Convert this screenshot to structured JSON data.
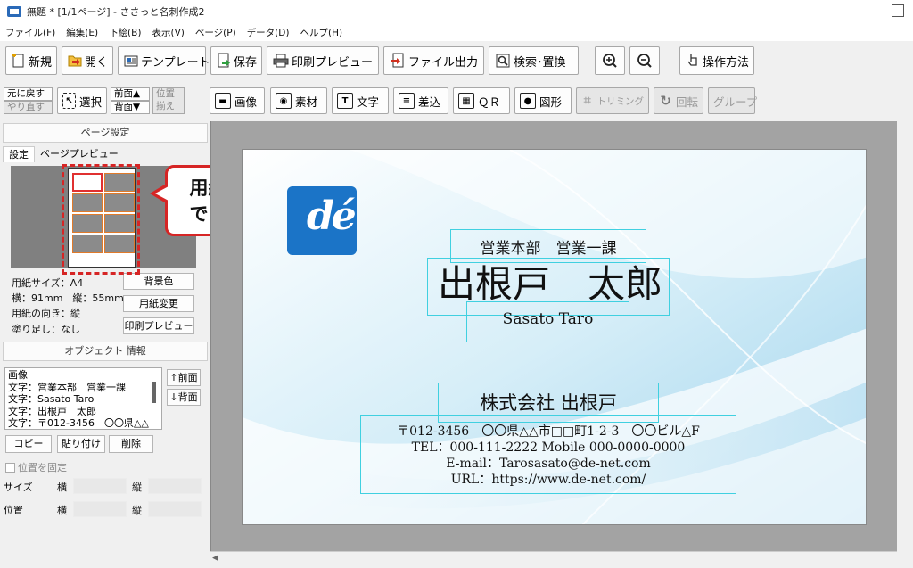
{
  "window": {
    "title": "無題 * [1/1ページ] - ささっと名刺作成2"
  },
  "menu": [
    "ファイル(F)",
    "編集(E)",
    "下絵(B)",
    "表示(V)",
    "ページ(P)",
    "データ(D)",
    "ヘルプ(H)"
  ],
  "toolbar1": {
    "new": "新規",
    "open": "開く",
    "template": "テンプレート",
    "save": "保存",
    "print_preview": "印刷プレビュー",
    "file_output": "ファイル出力",
    "search_replace": "検索･置換",
    "how_to": "操作方法"
  },
  "toolbar2": {
    "undo": "元に戻す",
    "redo": "やり直す",
    "select": "選択",
    "front": "前面▲",
    "back": "背面▼",
    "align_line1": "位置",
    "align_line2": "揃え",
    "image": "画像",
    "material": "素材",
    "text": "文字",
    "insert": "差込",
    "qr": "ＱＲ",
    "shape": "図形",
    "trimming": "トリミング",
    "rotate": "回転",
    "group": "グループ"
  },
  "left": {
    "page_settings": "ページ設定",
    "tab_settings": "設定",
    "tab_preview": "ページプレビュー",
    "paper_size": "用紙サイズ：A4",
    "dimensions": "横：91mm　縦：55mm",
    "orientation": "用紙の向き：縦",
    "bleed": "塗り足し：なし",
    "bg_color_btn": "背景色",
    "change_paper_btn": "用紙変更",
    "print_preview_btn": "印刷プレビュー",
    "object_info": "オブジェクト 情報",
    "objects": [
      "画像",
      "文字：営業本部　営業一課",
      "文字：Sasato Taro",
      "文字：出根戸　太郎",
      "文字：〒012-3456　〇〇県△△"
    ],
    "to_front": "↑前面",
    "to_back": "↓背面",
    "copy": "コピー",
    "paste": "貼り付け",
    "delete": "削除",
    "fix_position": "位置を固定",
    "size_label": "サイズ",
    "position_label": "位置",
    "width_label": "横",
    "height_label": "縦"
  },
  "callout": {
    "line1": "用紙変更が",
    "line2": "できました"
  },
  "card": {
    "logo_text": "dé",
    "department": "営業本部　営業一課",
    "name": "出根戸　太郎",
    "name_roman": "Sasato Taro",
    "company": "株式会社 出根戸",
    "address": "〒012-3456　〇〇県△△市□□町1-2-3　〇〇ビル△F",
    "tel": "TEL：000-111-2222 Mobile 000-0000-0000",
    "email": "E-mail：Tarosasato@de-net.com",
    "url": "URL：https://www.de-net.com/"
  },
  "colors": {
    "accent_red": "#d62525",
    "selection_cyan": "#40d0e0",
    "logo_blue": "#1b74c7"
  }
}
